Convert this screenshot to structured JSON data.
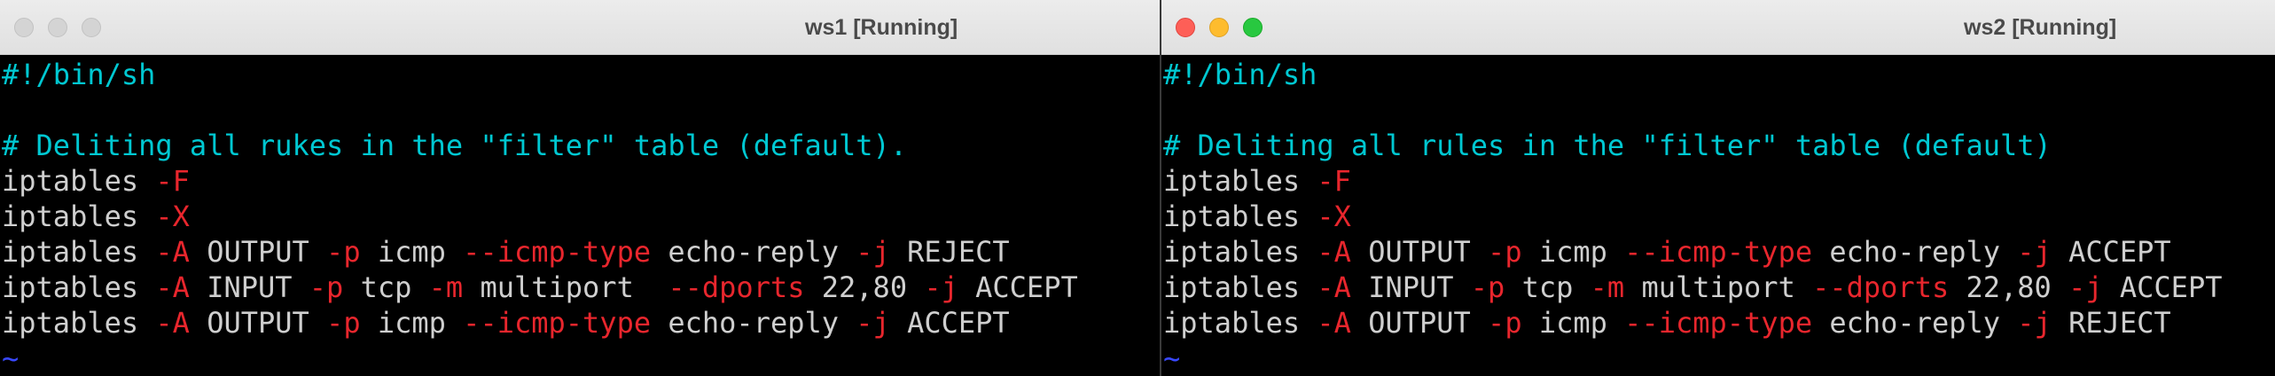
{
  "colors": {
    "default": "#cfcfcf",
    "comment": "#00c8d2",
    "flag": "#e8262d",
    "number": "#d838d8",
    "tilde": "#3848ff"
  },
  "windows": [
    {
      "id": "ws1",
      "title": "ws1 [Running]",
      "active": false,
      "lines": [
        [
          [
            "comment",
            "#!/bin/sh"
          ]
        ],
        [],
        [
          [
            "comment",
            "# Deliting all rukes in the \"filter\" table (default)."
          ]
        ],
        [
          [
            "default",
            "iptables "
          ],
          [
            "flag",
            "-F"
          ]
        ],
        [
          [
            "default",
            "iptables "
          ],
          [
            "flag",
            "-X"
          ]
        ],
        [
          [
            "default",
            "iptables "
          ],
          [
            "flag",
            "-A"
          ],
          [
            "default",
            " OUTPUT "
          ],
          [
            "flag",
            "-p"
          ],
          [
            "default",
            " icmp "
          ],
          [
            "flag",
            "--icmp-type"
          ],
          [
            "default",
            " echo-reply "
          ],
          [
            "flag",
            "-j"
          ],
          [
            "default",
            " REJECT"
          ]
        ],
        [
          [
            "default",
            "iptables "
          ],
          [
            "flag",
            "-A"
          ],
          [
            "default",
            " INPUT "
          ],
          [
            "flag",
            "-p"
          ],
          [
            "default",
            " tcp "
          ],
          [
            "flag",
            "-m"
          ],
          [
            "default",
            " multiport  "
          ],
          [
            "flag",
            "--dports"
          ],
          [
            "default",
            " "
          ],
          [
            "number",
            "22"
          ],
          [
            "default",
            ","
          ],
          [
            "number",
            "80"
          ],
          [
            "default",
            " "
          ],
          [
            "flag",
            "-j"
          ],
          [
            "default",
            " ACCEPT"
          ]
        ],
        [
          [
            "default",
            "iptables "
          ],
          [
            "flag",
            "-A"
          ],
          [
            "default",
            " OUTPUT "
          ],
          [
            "flag",
            "-p"
          ],
          [
            "default",
            " icmp "
          ],
          [
            "flag",
            "--icmp-type"
          ],
          [
            "default",
            " echo-reply "
          ],
          [
            "flag",
            "-j"
          ],
          [
            "default",
            " ACCEPT"
          ]
        ],
        [
          [
            "tilde",
            "~"
          ]
        ]
      ]
    },
    {
      "id": "ws2",
      "title": "ws2 [Running]",
      "active": true,
      "lines": [
        [
          [
            "comment",
            "#!/bin/sh"
          ]
        ],
        [],
        [
          [
            "comment",
            "# Deliting all rules in the \"filter\" table (default)"
          ]
        ],
        [
          [
            "default",
            "iptables "
          ],
          [
            "flag",
            "-F"
          ]
        ],
        [
          [
            "default",
            "iptables "
          ],
          [
            "flag",
            "-X"
          ]
        ],
        [
          [
            "default",
            "iptables "
          ],
          [
            "flag",
            "-A"
          ],
          [
            "default",
            " OUTPUT "
          ],
          [
            "flag",
            "-p"
          ],
          [
            "default",
            " icmp "
          ],
          [
            "flag",
            "--icmp-type"
          ],
          [
            "default",
            " echo-reply "
          ],
          [
            "flag",
            "-j"
          ],
          [
            "default",
            " ACCEPT"
          ]
        ],
        [
          [
            "default",
            "iptables "
          ],
          [
            "flag",
            "-A"
          ],
          [
            "default",
            " INPUT "
          ],
          [
            "flag",
            "-p"
          ],
          [
            "default",
            " tcp "
          ],
          [
            "flag",
            "-m"
          ],
          [
            "default",
            " multiport "
          ],
          [
            "flag",
            "--dports"
          ],
          [
            "default",
            " "
          ],
          [
            "number",
            "22"
          ],
          [
            "default",
            ","
          ],
          [
            "number",
            "80"
          ],
          [
            "default",
            " "
          ],
          [
            "flag",
            "-j"
          ],
          [
            "default",
            " ACCEPT"
          ]
        ],
        [
          [
            "default",
            "iptables "
          ],
          [
            "flag",
            "-A"
          ],
          [
            "default",
            " OUTPUT "
          ],
          [
            "flag",
            "-p"
          ],
          [
            "default",
            " icmp "
          ],
          [
            "flag",
            "--icmp-type"
          ],
          [
            "default",
            " echo-reply "
          ],
          [
            "flag",
            "-j"
          ],
          [
            "default",
            " REJECT"
          ]
        ],
        [
          [
            "tilde",
            "~"
          ]
        ]
      ]
    }
  ]
}
